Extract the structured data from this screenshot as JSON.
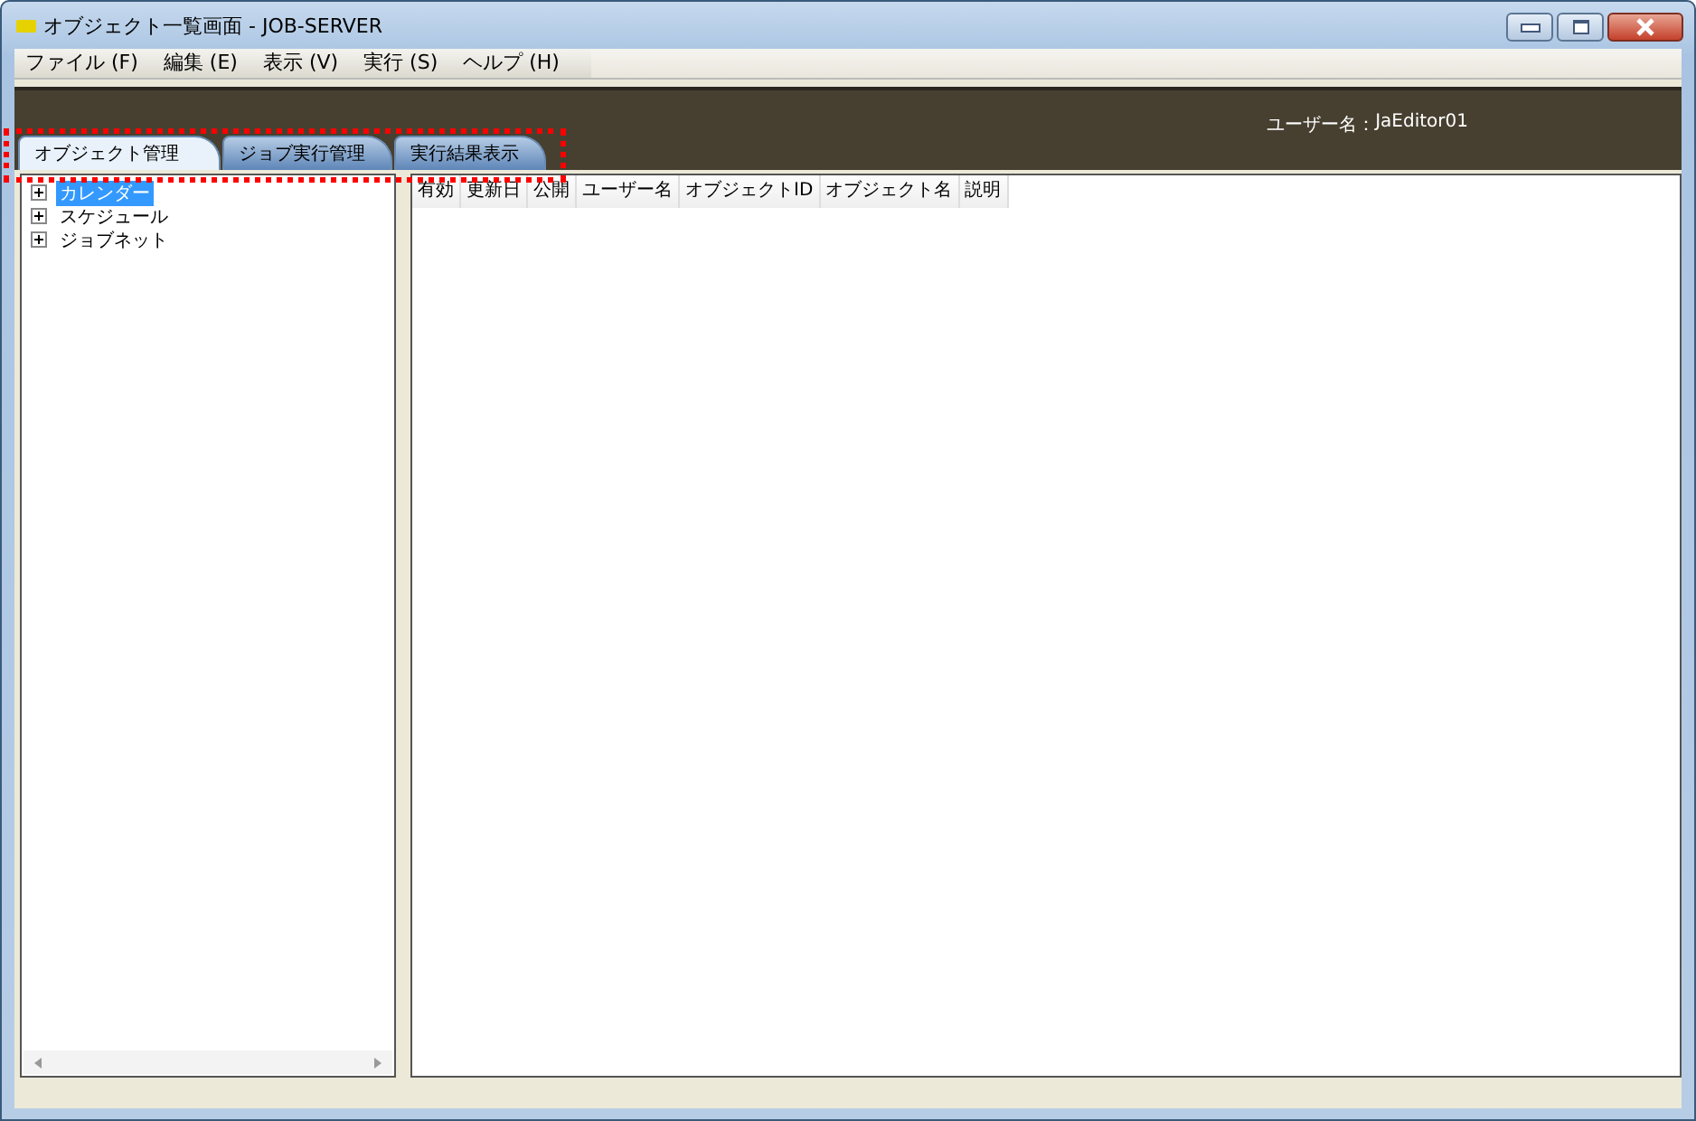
{
  "window": {
    "title": "オブジェクト一覧画面 - JOB-SERVER"
  },
  "menu": [
    "ファイル (F)",
    "編集 (E)",
    "表示 (V)",
    "実行 (S)",
    "ヘルプ (H)"
  ],
  "header": {
    "user_label": "ユーザー名：",
    "user_name": "JaEditor01"
  },
  "tabs": [
    {
      "label": "オブジェクト管理",
      "selected": true
    },
    {
      "label": "ジョブ実行管理",
      "selected": false
    },
    {
      "label": "実行結果表示",
      "selected": false
    }
  ],
  "tree": [
    {
      "label": "カレンダー",
      "selected": true,
      "expanded": false
    },
    {
      "label": "スケジュール",
      "selected": false,
      "expanded": false
    },
    {
      "label": "ジョブネット",
      "selected": false,
      "expanded": false
    }
  ],
  "table": {
    "columns": [
      "有効",
      "更新日",
      "公開",
      "ユーザー名",
      "オブジェクトID",
      "オブジェクト名",
      "説明"
    ]
  }
}
